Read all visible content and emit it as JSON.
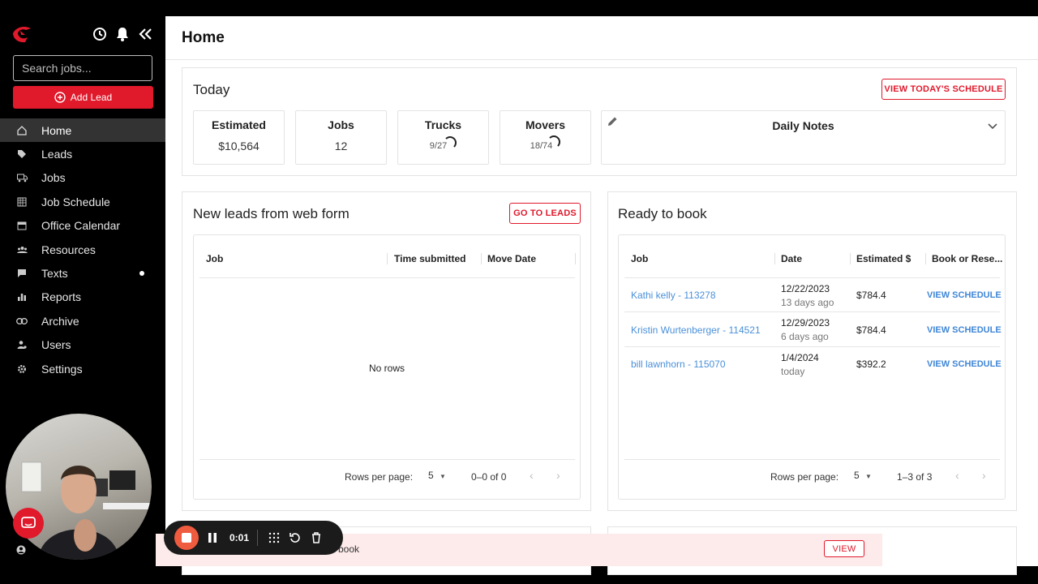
{
  "sidebar": {
    "search_placeholder": "Search jobs...",
    "add_lead_label": "Add Lead",
    "items": [
      {
        "label": "Home",
        "icon": "home-icon"
      },
      {
        "label": "Leads",
        "icon": "tag-icon"
      },
      {
        "label": "Jobs",
        "icon": "truck-icon"
      },
      {
        "label": "Job Schedule",
        "icon": "calendar-grid-icon"
      },
      {
        "label": "Office Calendar",
        "icon": "calendar-icon"
      },
      {
        "label": "Resources",
        "icon": "people-icon"
      },
      {
        "label": "Texts",
        "icon": "message-icon"
      },
      {
        "label": "Reports",
        "icon": "bar-chart-icon"
      },
      {
        "label": "Archive",
        "icon": "link-icon"
      },
      {
        "label": "Users",
        "icon": "users-icon"
      },
      {
        "label": "Settings",
        "icon": "gear-icon"
      }
    ]
  },
  "header": {
    "title": "Home"
  },
  "today": {
    "title": "Today",
    "schedule_button": "VIEW TODAY'S SCHEDULE",
    "stats": [
      {
        "label": "Estimated",
        "value": "$10,564"
      },
      {
        "label": "Jobs",
        "value": "12"
      },
      {
        "label": "Trucks",
        "value": "9/27"
      },
      {
        "label": "Movers",
        "value": "18/74"
      }
    ],
    "notes_title": "Daily Notes"
  },
  "new_leads": {
    "title": "New leads from web form",
    "button": "GO TO LEADS",
    "columns": [
      "Job",
      "Time submitted",
      "Move Date"
    ],
    "empty_text": "No rows",
    "rows_per_page_label": "Rows per page:",
    "rows_per_page": "5",
    "range": "0–0 of 0"
  },
  "ready": {
    "title": "Ready to book",
    "columns": [
      "Job",
      "Date",
      "Estimated $",
      "Book or Rese..."
    ],
    "rows": [
      {
        "job": "Kathi kelly - 113278",
        "date": "12/22/2023",
        "ago": "13 days ago",
        "est": "$784.4",
        "action": "VIEW SCHEDULE"
      },
      {
        "job": "Kristin Wurtenberger - 114521",
        "date": "12/29/2023",
        "ago": "6 days ago",
        "est": "$784.4",
        "action": "VIEW SCHEDULE"
      },
      {
        "job": "bill lawnhorn - 115070",
        "date": "1/4/2024",
        "ago": "today",
        "est": "$392.2",
        "action": "VIEW SCHEDULE"
      }
    ],
    "rows_per_page_label": "Rows per page:",
    "rows_per_page": "5",
    "range": "1–3 of 3"
  },
  "alert": {
    "text": "book",
    "button": "VIEW"
  },
  "recorder": {
    "time": "0:01"
  },
  "colors": {
    "accent": "#e0192b",
    "link": "#4a90d9",
    "sidebar_active": "#333333"
  }
}
